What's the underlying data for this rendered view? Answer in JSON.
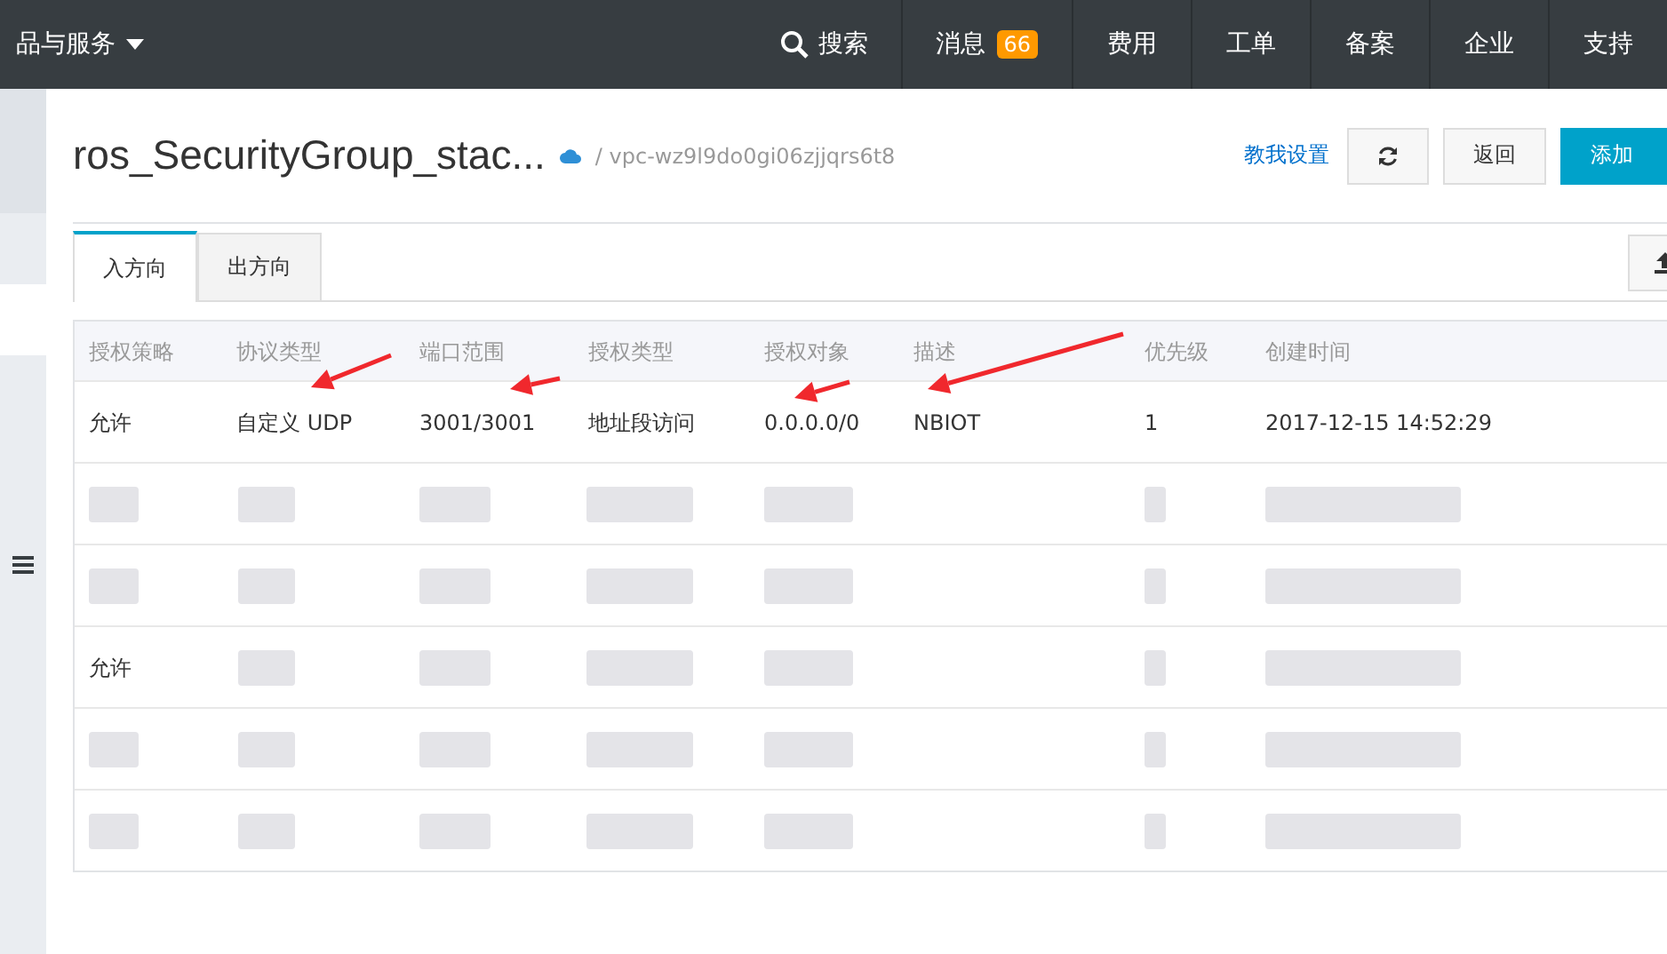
{
  "topbar": {
    "products_menu": "品与服务",
    "search": "搜索",
    "nav": [
      {
        "label": "消息",
        "badge": "66"
      },
      {
        "label": "费用"
      },
      {
        "label": "工单"
      },
      {
        "label": "备案"
      },
      {
        "label": "企业"
      },
      {
        "label": "支持"
      }
    ]
  },
  "header": {
    "title": "ros_SecurityGroup_stac...",
    "breadcrumb": "/ vpc-wz9l9do0gi06zjjqrs6t8",
    "help_link": "教我设置",
    "back_button": "返回",
    "add_button": "添加"
  },
  "tabs": [
    {
      "label": "入方向",
      "selected": true
    },
    {
      "label": "出方向",
      "selected": false
    }
  ],
  "table": {
    "columns": [
      "授权策略",
      "协议类型",
      "端口范围",
      "授权类型",
      "授权对象",
      "描述",
      "优先级",
      "创建时间"
    ],
    "rows": [
      {
        "redacted": false,
        "cells": [
          "允许",
          "自定义 UDP",
          "3001/3001",
          "地址段访问",
          "0.0.0.0/0",
          "NBIOT",
          "1",
          "2017-12-15 14:52:29"
        ]
      },
      {
        "redacted": true,
        "cells": []
      },
      {
        "redacted": true,
        "cells": []
      },
      {
        "redacted": true,
        "cells": [
          "允许"
        ]
      },
      {
        "redacted": true,
        "cells": []
      },
      {
        "redacted": true,
        "cells": []
      }
    ]
  }
}
